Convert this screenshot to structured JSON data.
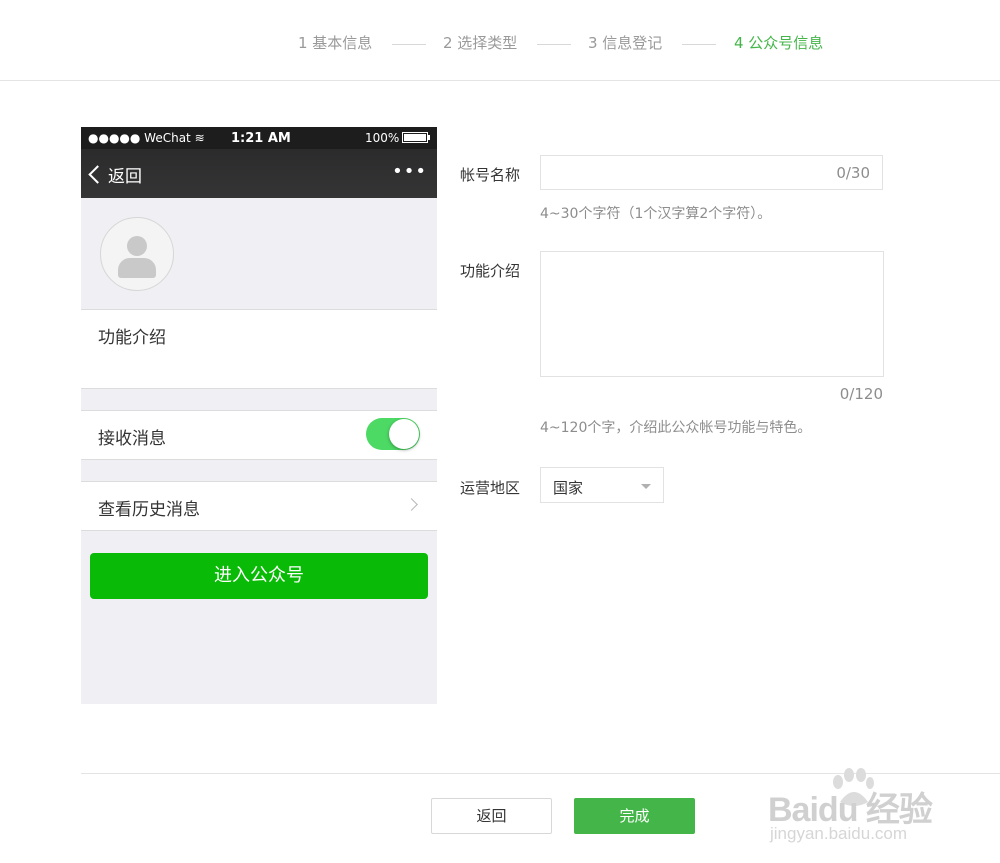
{
  "steps": [
    {
      "label": "1 基本信息"
    },
    {
      "label": "2 选择类型"
    },
    {
      "label": "3 信息登记"
    },
    {
      "label": "4 公众号信息"
    }
  ],
  "phone": {
    "carrier": "●●●●● WeChat ≋",
    "time": "1:21 AM",
    "battery": "100%",
    "back_label": "返回",
    "more": "•••",
    "intro_label": "功能介绍",
    "receive_label": "接收消息",
    "receive_on": true,
    "history_label": "查看历史消息",
    "enter_button": "进入公众号"
  },
  "form": {
    "name_label": "帐号名称",
    "name_count": "0/30",
    "name_tip": "4~30个字符（1个汉字算2个字符）。",
    "intro_label": "功能介绍",
    "intro_count": "0/120",
    "intro_tip": "4~120个字，介绍此公众帐号功能与特色。",
    "region_label": "运营地区",
    "region_value": "国家"
  },
  "footer": {
    "back_button": "返回",
    "done_button": "完成"
  },
  "watermark": {
    "brand": "Bai",
    "brand2": "du 经验",
    "url": "jingyan.baidu.com"
  },
  "colors": {
    "accent": "#44b549",
    "wechat_green": "#09bb07",
    "toggle_on": "#4cd964"
  }
}
